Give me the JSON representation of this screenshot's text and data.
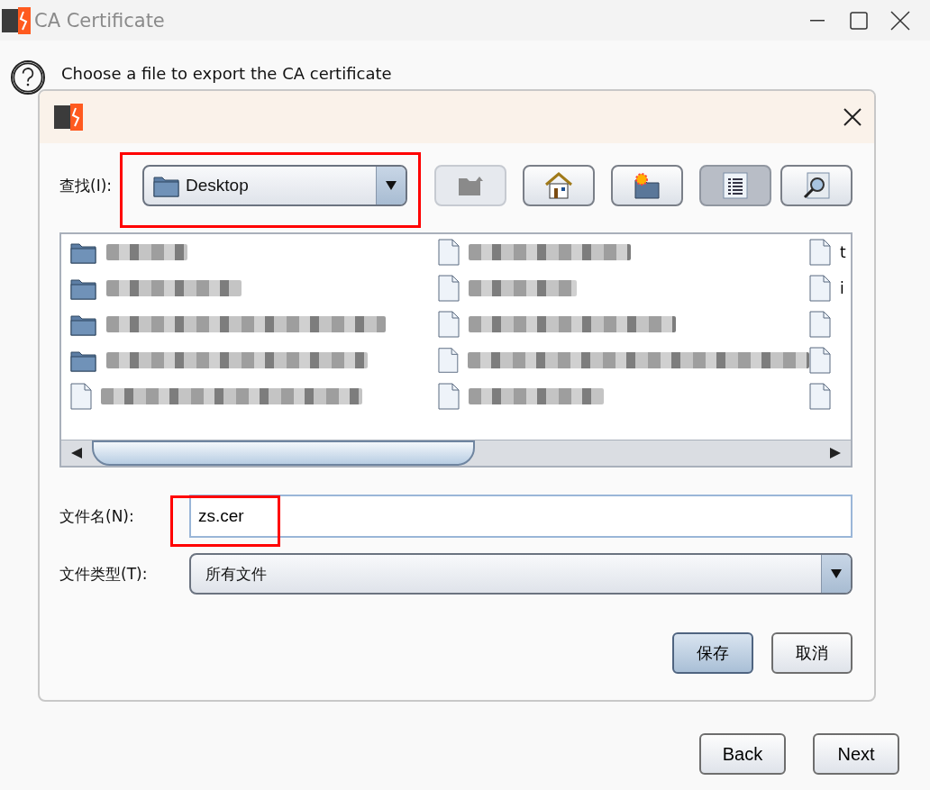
{
  "window": {
    "title": "CA Certificate",
    "prompt": "Choose a file to export the CA certificate",
    "buttons": [
      {
        "label": "Back"
      },
      {
        "label": "Next"
      }
    ]
  },
  "dialog": {
    "look_in": {
      "label": "查找(I):",
      "value": "Desktop"
    },
    "toolbar": [
      {
        "kind": "up",
        "disabled": true,
        "selected": false
      },
      {
        "kind": "home",
        "disabled": false,
        "selected": false
      },
      {
        "kind": "new-folder",
        "disabled": false,
        "selected": false
      },
      {
        "kind": "list",
        "disabled": false,
        "selected": true
      },
      {
        "kind": "details",
        "disabled": false,
        "selected": false
      }
    ],
    "file_list": {
      "columns": [
        {
          "items": [
            {
              "kind": "folder"
            },
            {
              "kind": "folder"
            },
            {
              "kind": "folder"
            },
            {
              "kind": "folder"
            },
            {
              "kind": "file"
            }
          ]
        },
        {
          "items": [
            {
              "kind": "file"
            },
            {
              "kind": "file"
            },
            {
              "kind": "file"
            },
            {
              "kind": "file"
            },
            {
              "kind": "file"
            }
          ]
        },
        {
          "items": [
            {
              "kind": "file",
              "label": "t"
            },
            {
              "kind": "file",
              "label": "i"
            },
            {
              "kind": "file"
            },
            {
              "kind": "file"
            },
            {
              "kind": "file"
            }
          ]
        }
      ]
    },
    "file_name": {
      "label": "文件名(N):",
      "value": "zs.cer"
    },
    "file_type": {
      "label": "文件类型(T):",
      "value": "所有文件"
    },
    "buttons": [
      {
        "label": "保存",
        "selected": true
      },
      {
        "label": "取消",
        "selected": false
      }
    ]
  }
}
